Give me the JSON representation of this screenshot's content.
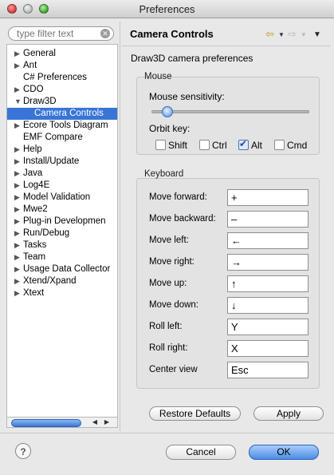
{
  "window": {
    "title": "Preferences"
  },
  "sidebar": {
    "filter_placeholder": "type filter text",
    "items": [
      {
        "label": "General",
        "arrow": "▶",
        "child": false,
        "selected": false
      },
      {
        "label": "Ant",
        "arrow": "▶",
        "child": false,
        "selected": false
      },
      {
        "label": "C# Preferences",
        "arrow": "",
        "child": false,
        "selected": false
      },
      {
        "label": "CDO",
        "arrow": "▶",
        "child": false,
        "selected": false
      },
      {
        "label": "Draw3D",
        "arrow": "▼",
        "child": false,
        "selected": false
      },
      {
        "label": "Camera Controls",
        "arrow": "",
        "child": true,
        "selected": true
      },
      {
        "label": "Ecore Tools Diagram",
        "arrow": "▶",
        "child": false,
        "selected": false
      },
      {
        "label": "EMF Compare",
        "arrow": "",
        "child": false,
        "selected": false
      },
      {
        "label": "Help",
        "arrow": "▶",
        "child": false,
        "selected": false
      },
      {
        "label": "Install/Update",
        "arrow": "▶",
        "child": false,
        "selected": false
      },
      {
        "label": "Java",
        "arrow": "▶",
        "child": false,
        "selected": false
      },
      {
        "label": "Log4E",
        "arrow": "▶",
        "child": false,
        "selected": false
      },
      {
        "label": "Model Validation",
        "arrow": "▶",
        "child": false,
        "selected": false
      },
      {
        "label": "Mwe2",
        "arrow": "▶",
        "child": false,
        "selected": false
      },
      {
        "label": "Plug-in Developmen",
        "arrow": "▶",
        "child": false,
        "selected": false
      },
      {
        "label": "Run/Debug",
        "arrow": "▶",
        "child": false,
        "selected": false
      },
      {
        "label": "Tasks",
        "arrow": "▶",
        "child": false,
        "selected": false
      },
      {
        "label": "Team",
        "arrow": "▶",
        "child": false,
        "selected": false
      },
      {
        "label": "Usage Data Collector",
        "arrow": "▶",
        "child": false,
        "selected": false
      },
      {
        "label": "Xtend/Xpand",
        "arrow": "▶",
        "child": false,
        "selected": false
      },
      {
        "label": "Xtext",
        "arrow": "▶",
        "child": false,
        "selected": false
      }
    ]
  },
  "page": {
    "title": "Camera Controls",
    "description": "Draw3D camera preferences"
  },
  "mouse": {
    "group_label": "Mouse",
    "sensitivity_label": "Mouse sensitivity:",
    "sensitivity_value": 0.06,
    "orbit_label": "Orbit key:",
    "orbit_keys": [
      {
        "label": "Shift",
        "checked": false
      },
      {
        "label": "Ctrl",
        "checked": false
      },
      {
        "label": "Alt",
        "checked": true
      },
      {
        "label": "Cmd",
        "checked": false
      }
    ]
  },
  "keyboard": {
    "group_label": "Keyboard",
    "bindings": [
      {
        "label": "Move forward:",
        "value": "+"
      },
      {
        "label": "Move backward:",
        "value": "–"
      },
      {
        "label": "Move left:",
        "value": "←"
      },
      {
        "label": "Move right:",
        "value": "→"
      },
      {
        "label": "Move up:",
        "value": "↑"
      },
      {
        "label": "Move down:",
        "value": "↓"
      },
      {
        "label": "Roll left:",
        "value": "Y"
      },
      {
        "label": "Roll right:",
        "value": "X"
      },
      {
        "label": "Center view",
        "value": "Esc"
      }
    ]
  },
  "buttons": {
    "restore_defaults": "Restore Defaults",
    "apply": "Apply",
    "cancel": "Cancel",
    "ok": "OK",
    "help": "?"
  },
  "icons": {
    "back": "back-arrow-icon",
    "forward": "forward-arrow-icon",
    "menu": "view-menu-icon",
    "clear": "clear-filter-icon",
    "help": "help-icon"
  }
}
